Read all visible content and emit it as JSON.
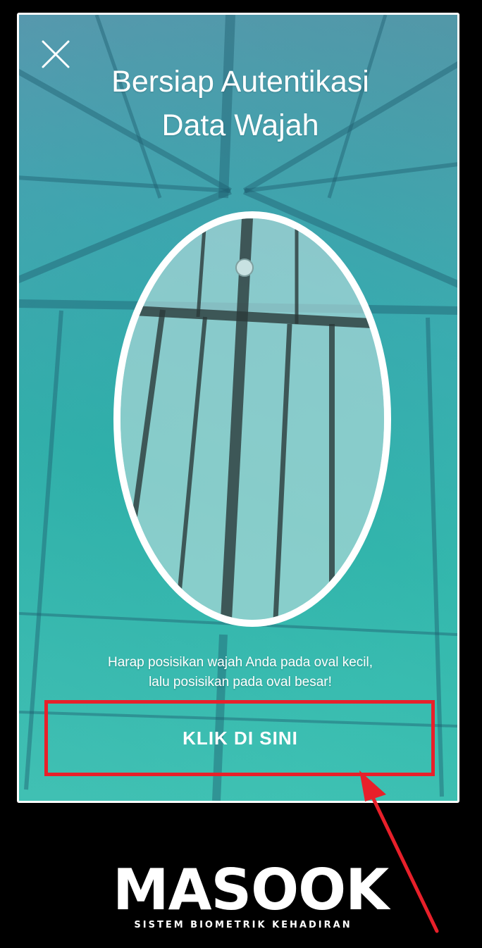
{
  "screen": {
    "title_line1": "Bersiap Autentikasi",
    "title_line2": "Data Wajah",
    "close_icon": "close-icon",
    "instruction_line1": "Harap posisikan wajah Anda pada oval kecil,",
    "instruction_line2": "lalu posisikan pada oval besar!",
    "button_label": "KLIK DI SINI"
  },
  "annotation": {
    "highlight_color": "#e8202a",
    "arrow_color": "#e8202a"
  },
  "brand": {
    "logo": "MASOOK",
    "tagline": "SISTEM BIOMETRIK KEHADIRAN"
  },
  "colors": {
    "accent_teal": "#2fb1aa",
    "background": "#000000"
  }
}
